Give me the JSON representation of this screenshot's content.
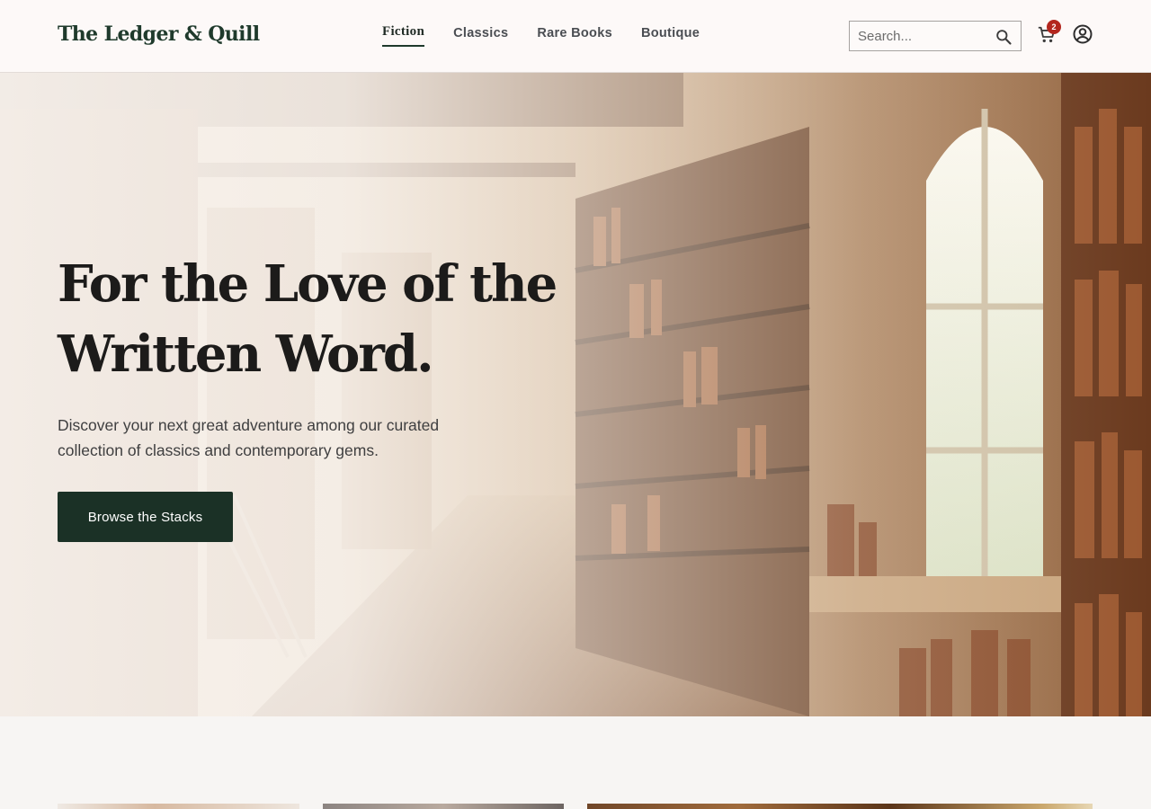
{
  "brand": {
    "name": "The Ledger & Quill"
  },
  "nav": {
    "items": [
      {
        "label": "Fiction",
        "active": true
      },
      {
        "label": "Classics",
        "active": false
      },
      {
        "label": "Rare Books",
        "active": false
      },
      {
        "label": "Boutique",
        "active": false
      }
    ]
  },
  "search": {
    "placeholder": "Search...",
    "icon": "search-icon"
  },
  "cart": {
    "count": "2",
    "icon": "cart-icon"
  },
  "account": {
    "icon": "account-icon"
  },
  "hero": {
    "title": "For the Love of the Written Word.",
    "subtitle": "Discover your next great adventure among our curated collection of classics and contemporary gems.",
    "cta_label": "Browse the Stacks",
    "image_alt": "library interior with tall bookshelves and arched window"
  },
  "colors": {
    "brand_green": "#1b3126",
    "badge_red": "#b3261e",
    "header_bg": "#fdf9f8",
    "page_bg": "#f7f5f3"
  }
}
